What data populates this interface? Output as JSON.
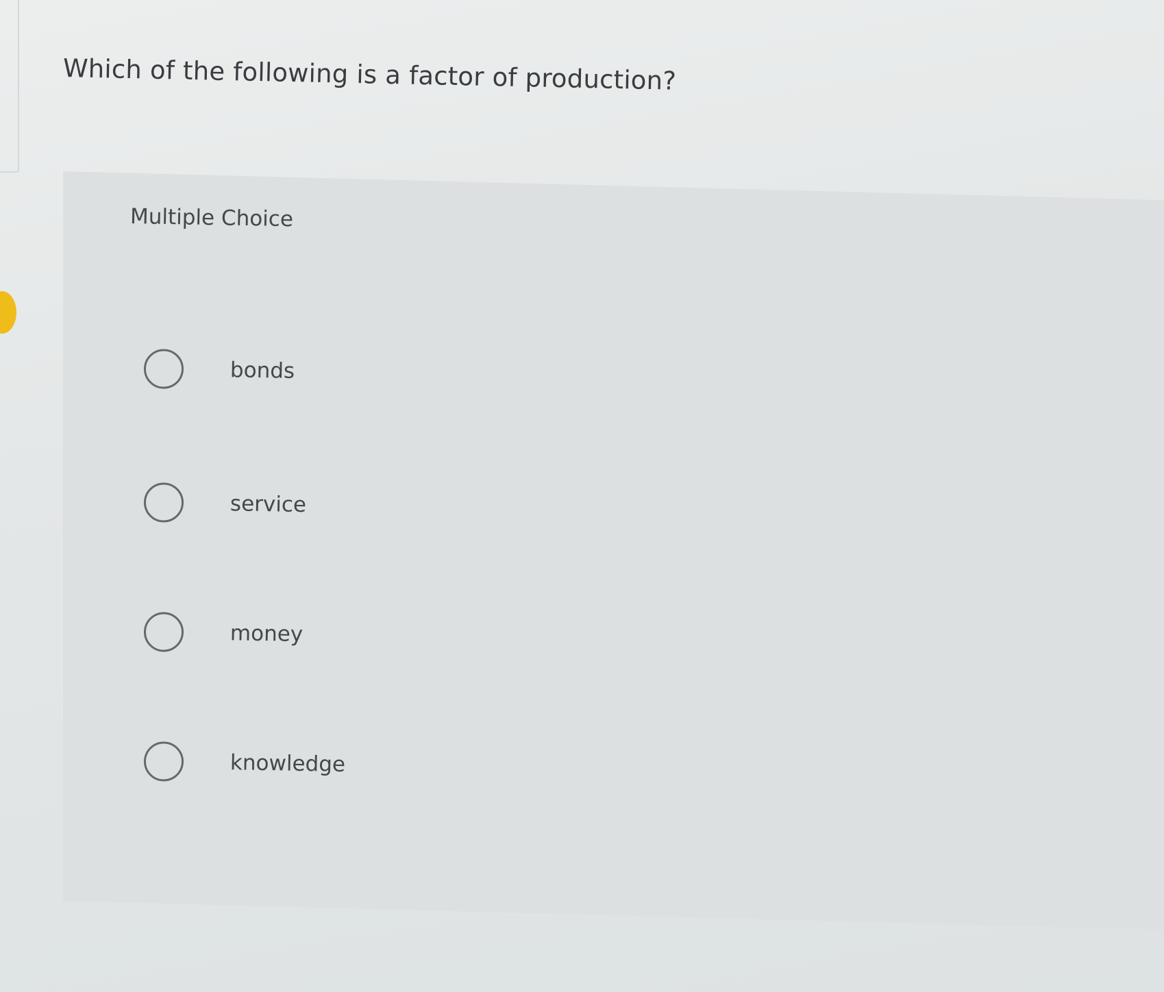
{
  "question": {
    "text": "Which of the following is a factor of production?"
  },
  "multiple_choice": {
    "title": "Multiple Choice",
    "options": [
      {
        "label": "bonds",
        "selected": false
      },
      {
        "label": "service",
        "selected": false
      },
      {
        "label": "money",
        "selected": false
      },
      {
        "label": "knowledge",
        "selected": false
      }
    ]
  },
  "colors": {
    "background": "#e3e6e6",
    "panel": "#dde0e0",
    "text": "#3d3f42",
    "radio_border": "#66696c",
    "marker": "#f0bc1a"
  }
}
